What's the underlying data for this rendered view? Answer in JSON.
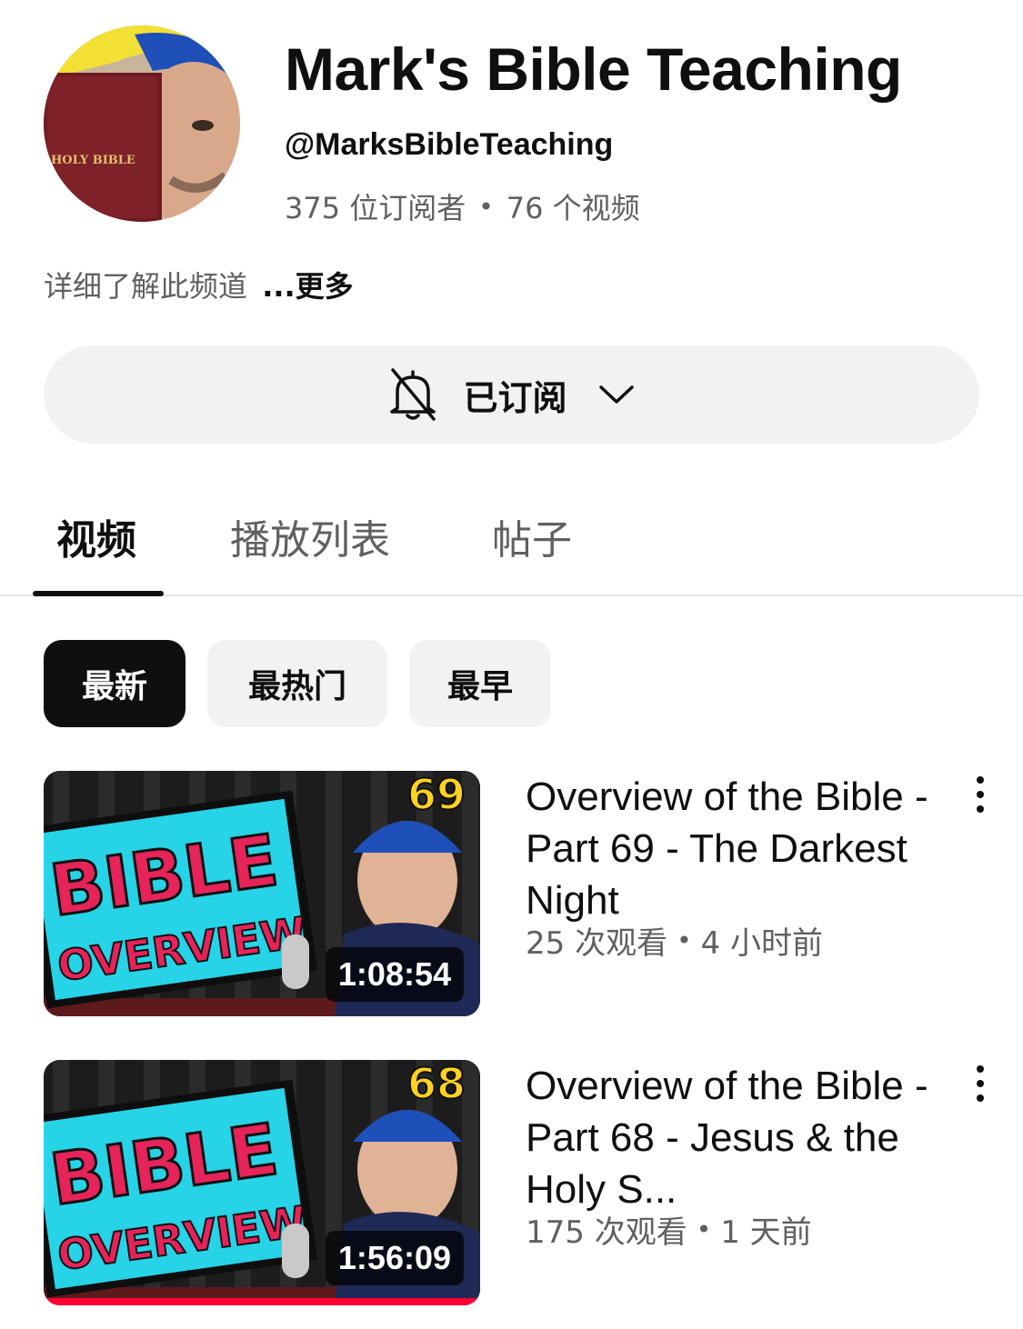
{
  "channel": {
    "name": "Mark's Bible Teaching",
    "handle": "@MarksBibleTeaching",
    "subscribers": "375 位订阅者",
    "videos_count": "76 个视频",
    "about_text": "详细了解此频道",
    "more_label": "...更多",
    "avatar_book_text": "HOLY BIBLE"
  },
  "subscribe": {
    "label": "已订阅",
    "bell_icon": "bell-off-icon",
    "chevron_icon": "chevron-down-icon"
  },
  "tabs": [
    {
      "label": "视频",
      "active": true
    },
    {
      "label": "播放列表",
      "active": false
    },
    {
      "label": "帖子",
      "active": false
    }
  ],
  "chips": [
    {
      "label": "最新",
      "active": true
    },
    {
      "label": "最热门",
      "active": false
    },
    {
      "label": "最早",
      "active": false
    }
  ],
  "videos": [
    {
      "title": "Overview of the Bible - Part 69 - The Darkest Night",
      "views": "25 次观看",
      "age": "4 小时前",
      "duration": "1:08:54",
      "thumb_number": "69",
      "thumb_line1": "BIBLE",
      "thumb_line2": "OVERVIEW",
      "watched_fraction": 0
    },
    {
      "title": "Overview of the Bible - Part 68 - Jesus & the Holy S...",
      "views": "175 次观看",
      "age": "1 天前",
      "duration": "1:56:09",
      "thumb_number": "68",
      "thumb_line1": "BIBLE",
      "thumb_line2": "OVERVIEW",
      "watched_fraction": 1
    }
  ],
  "colors": {
    "text_primary": "#0f0f0f",
    "text_secondary": "#606060",
    "chip_bg": "#f2f2f2",
    "progress_red": "#ff0033",
    "thumb_cyan": "#27d3e6",
    "thumb_pink": "#e6245a",
    "thumb_yellow": "#ffd21f"
  }
}
